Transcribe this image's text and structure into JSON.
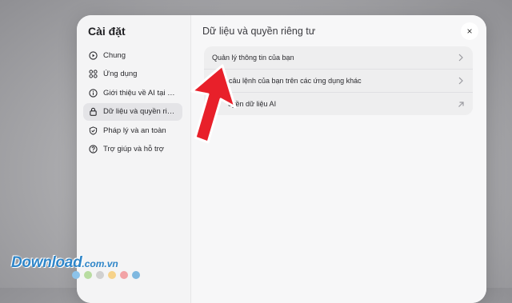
{
  "sidebar": {
    "title": "Cài đặt",
    "items": [
      {
        "label": "Chung",
        "icon": "play-circle-icon"
      },
      {
        "label": "Ứng dụng",
        "icon": "apps-grid-icon"
      },
      {
        "label": "Giới thiệu về AI tại M…",
        "icon": "info-icon"
      },
      {
        "label": "Dữ liệu và quyền riê…",
        "icon": "lock-icon",
        "active": true
      },
      {
        "label": "Pháp lý và an toàn",
        "icon": "shield-check-icon"
      },
      {
        "label": "Trợ giúp và hỗ trợ",
        "icon": "help-icon"
      }
    ]
  },
  "main": {
    "title": "Dữ liệu và quyền riêng tư",
    "rows": [
      {
        "label": "Quản lý thông tin của bạn",
        "icon": "chevron-right-icon"
      },
      {
        "label": "ý câu lệnh của bạn trên các ứng dụng khác",
        "icon": "chevron-right-icon"
      },
      {
        "label": "uyền dữ liệu AI",
        "icon": "external-arrow-icon"
      }
    ]
  },
  "close_symbol": "×",
  "watermark": {
    "name": "Download",
    "domain": ".com.vn"
  },
  "colors": {
    "arrow": "#e8202a",
    "watermark": "#2f86c9",
    "active_item": "#e4e4e7",
    "dots": [
      "#8cc3ea",
      "#b8dca0",
      "#d0d0d0",
      "#f6d28a",
      "#f2a3a6",
      "#7fb8e0"
    ]
  }
}
